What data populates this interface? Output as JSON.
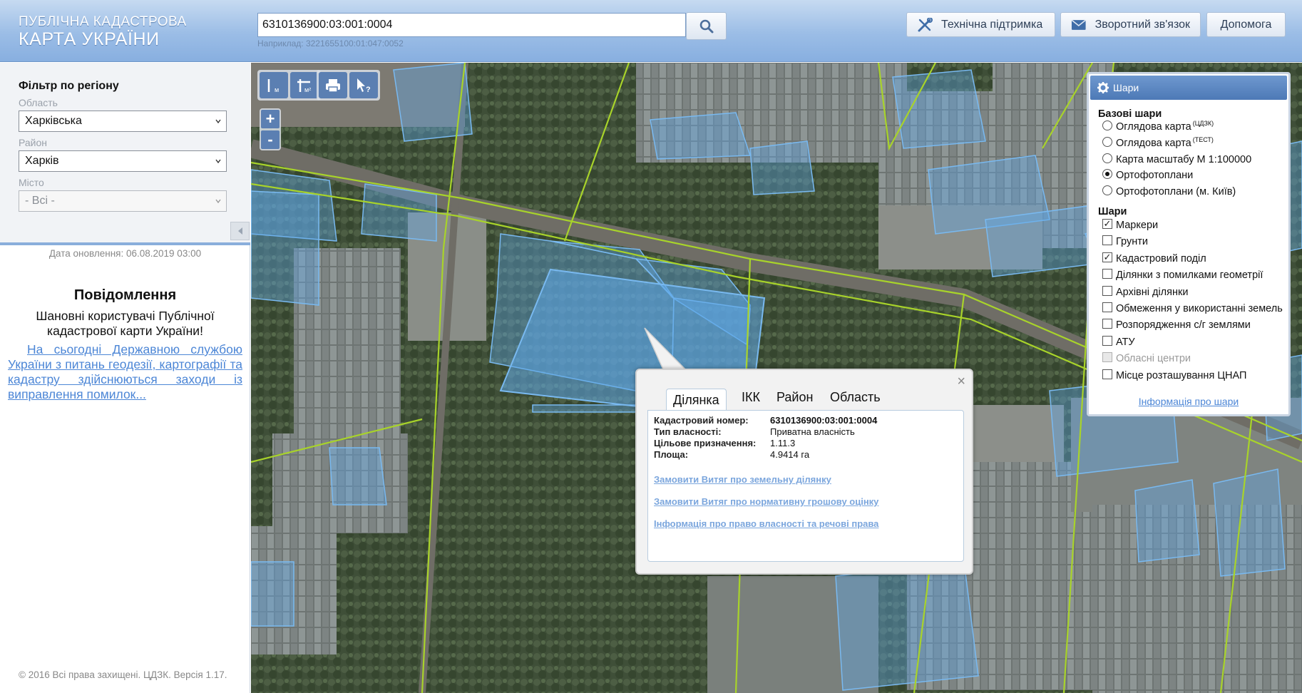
{
  "header": {
    "logo_line1": "ПУБЛІЧНА КАДАСТРОВА",
    "logo_line2": "КАРТА УКРАЇНИ",
    "search_value": "6310136900:03:001:0004",
    "search_hint": "Наприклад: 3221655100:01:047:0052",
    "tech_support_label": "Технічна підтримка",
    "feedback_label": "Зворотний зв'язок",
    "help_label": "Допомога"
  },
  "filter": {
    "title": "Фільтр по регіону",
    "region_label": "Область",
    "region_value": "Харківська",
    "district_label": "Район",
    "district_value": "Харків",
    "city_label": "Місто",
    "city_value": "- Всі -"
  },
  "left_panel": {
    "update_date": "Дата оновлення: 06.08.2019 03:00",
    "message_title": "Повідомлення",
    "message_greeting": "Шановні користувачі Публічної кадастрової карти України!",
    "message_link": "На сьогодні Державною службою України з питань геодезії, картографії та кадастру здійснюються заходи із виправлення помилок...",
    "copyright": "© 2016 Всі права захищені. ЦДЗК. Версія 1.17."
  },
  "layers": {
    "title": "Шари",
    "base_section": "Базові шари",
    "base_layers": [
      {
        "label": "Оглядова карта",
        "sup": "(ЦДЗК)",
        "selected": false
      },
      {
        "label": "Оглядова карта",
        "sup": "(ТЕСТ)",
        "selected": false
      },
      {
        "label": "Карта масштабу М 1:100000",
        "sup": "",
        "selected": false
      },
      {
        "label": "Ортофотоплани",
        "sup": "",
        "selected": true
      },
      {
        "label": "Ортофотоплани (м. Київ)",
        "sup": "",
        "selected": false
      }
    ],
    "layers_section": "Шари",
    "overlay_layers": [
      {
        "label": "Маркери",
        "checked": true,
        "disabled": false
      },
      {
        "label": "Грунти",
        "checked": false,
        "disabled": false
      },
      {
        "label": "Кадастровий поділ",
        "checked": true,
        "disabled": false
      },
      {
        "label": "Ділянки з помилками геометрії",
        "checked": false,
        "disabled": false
      },
      {
        "label": "Архівні ділянки",
        "checked": false,
        "disabled": false
      },
      {
        "label": "Обмеження у використанні земель",
        "checked": false,
        "disabled": false
      },
      {
        "label": "Розпорядження с/г землями",
        "checked": false,
        "disabled": false
      },
      {
        "label": "АТУ",
        "checked": false,
        "disabled": false
      },
      {
        "label": "Обласні центри",
        "checked": false,
        "disabled": true
      },
      {
        "label": "Місце розташування ЦНАП",
        "checked": false,
        "disabled": false
      }
    ],
    "info_link": "Інформація про шари"
  },
  "popup": {
    "tabs": [
      "Ділянка",
      "ІКК",
      "Район",
      "Область"
    ],
    "active_tab": 0,
    "close": "×",
    "fields": [
      {
        "key": "Кадастровий номер:",
        "value": "6310136900:03:001:0004"
      },
      {
        "key": "Тип власності:",
        "value": "Приватна власність"
      },
      {
        "key": "Цільове призначення:",
        "value": "1.11.3"
      },
      {
        "key": "Площа:",
        "value": "4.9414 га"
      }
    ],
    "links": [
      "Замовити Витяг про земельну ділянку",
      "Замовити Витяг про нормативну грошову оцінку",
      "Інформація про право власності та речові права"
    ]
  },
  "map_tools": {
    "zoom_in": "+",
    "zoom_out": "-"
  },
  "colors": {
    "accent": "#5b7fb2",
    "header": "#9bbde6",
    "link": "#4c86d6",
    "parcel": "#5fa8e8",
    "boundary": "#a8d32a"
  }
}
